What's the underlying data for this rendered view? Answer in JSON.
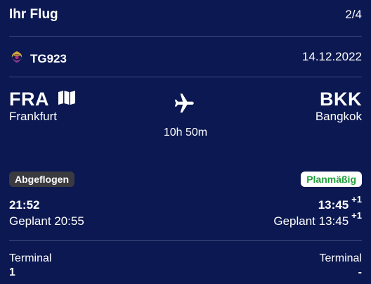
{
  "header": {
    "title": "Ihr Flug",
    "step": "2/4"
  },
  "flight": {
    "airline_icon": "thai-airways-logo-icon",
    "number": "TG923",
    "date": "14.12.2022"
  },
  "origin": {
    "code": "FRA",
    "city": "Frankfurt",
    "map_icon": "map-icon"
  },
  "destination": {
    "code": "BKK",
    "city": "Bangkok"
  },
  "route": {
    "plane_icon": "airplane-icon",
    "duration": "10h 50m"
  },
  "status": {
    "departure_badge": "Abgeflogen",
    "arrival_badge": "Planmäßig",
    "arrival_badge_color": "#22a03a"
  },
  "departure": {
    "actual": "21:52",
    "scheduled": "Geplant 20:55"
  },
  "arrival": {
    "actual": "13:45",
    "actual_day_offset": "+1",
    "scheduled": "Geplant 13:45",
    "scheduled_day_offset": "+1"
  },
  "terminal": {
    "departure_label": "Terminal",
    "departure_value": "1",
    "arrival_label": "Terminal",
    "arrival_value": "-"
  },
  "colors": {
    "background": "#0b1851",
    "divider": "#3f4a7c",
    "text": "#ffffff"
  }
}
